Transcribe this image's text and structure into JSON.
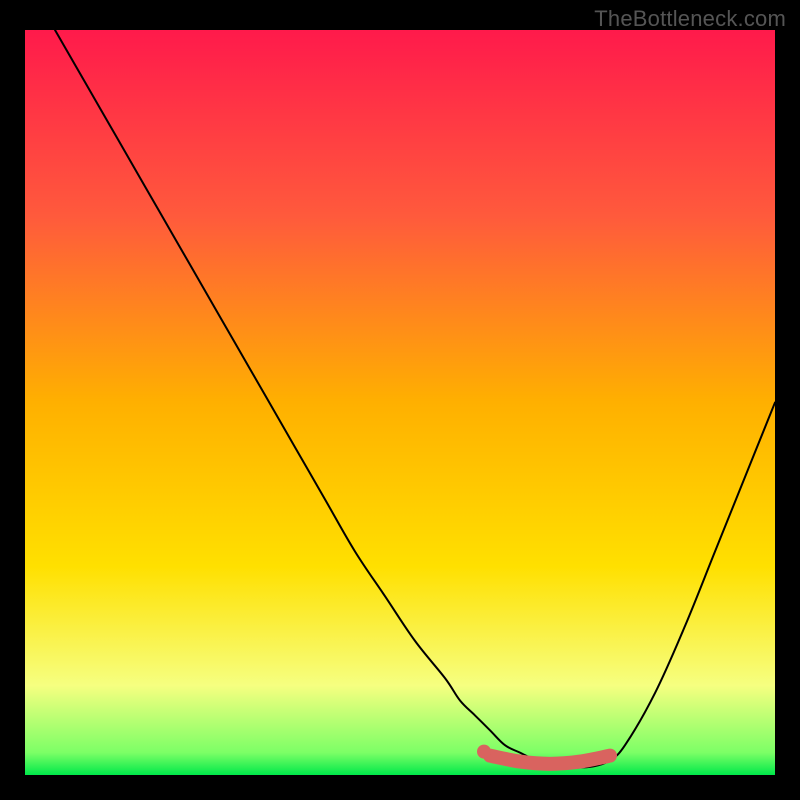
{
  "watermark": "TheBottleneck.com",
  "chart_data": {
    "type": "line",
    "title": "",
    "xlabel": "",
    "ylabel": "",
    "xlim": [
      0,
      100
    ],
    "ylim": [
      0,
      100
    ],
    "series": [
      {
        "name": "bottleneck-curve",
        "x": [
          4,
          8,
          12,
          16,
          20,
          24,
          28,
          32,
          36,
          40,
          44,
          48,
          52,
          56,
          58,
          60,
          62,
          64,
          66,
          68,
          70,
          72,
          74,
          76,
          78,
          80,
          84,
          88,
          92,
          96,
          100
        ],
        "y": [
          100,
          93,
          86,
          79,
          72,
          65,
          58,
          51,
          44,
          37,
          30,
          24,
          18,
          13,
          10,
          8,
          6,
          4,
          3,
          2,
          1.2,
          1,
          1,
          1.2,
          2,
          4,
          11,
          20,
          30,
          40,
          50
        ]
      },
      {
        "name": "optimal-zone-marker",
        "x": [
          62,
          66,
          70,
          74,
          78
        ],
        "y": [
          2.6,
          1.8,
          1.5,
          1.8,
          2.6
        ]
      }
    ],
    "gradient_stops": [
      {
        "offset": 0,
        "color": "#ff1a4b"
      },
      {
        "offset": 25,
        "color": "#ff5a3c"
      },
      {
        "offset": 50,
        "color": "#ffb000"
      },
      {
        "offset": 72,
        "color": "#ffe000"
      },
      {
        "offset": 88,
        "color": "#f6ff80"
      },
      {
        "offset": 97,
        "color": "#7cff66"
      },
      {
        "offset": 100,
        "color": "#00e84a"
      }
    ],
    "marker_color": "#d9635f",
    "curve_color": "#000000"
  }
}
